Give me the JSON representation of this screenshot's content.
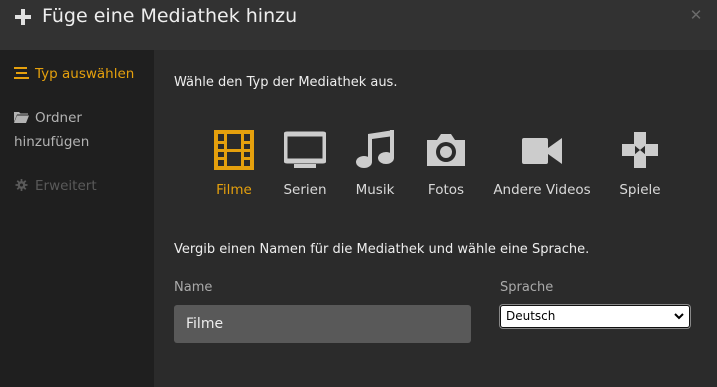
{
  "dialog": {
    "title": "Füge eine Mediathek hinzu"
  },
  "sidebar": {
    "items": [
      {
        "label": "Typ auswählen",
        "state": "active"
      },
      {
        "label": "Ordner hinzufügen",
        "state": "normal"
      },
      {
        "label": "Erweitert",
        "state": "disabled"
      }
    ]
  },
  "main": {
    "intro": "Wähle den Typ der Mediathek aus.",
    "types": [
      {
        "label": "Filme",
        "icon": "film-icon",
        "selected": true
      },
      {
        "label": "Serien",
        "icon": "tv-icon",
        "selected": false
      },
      {
        "label": "Musik",
        "icon": "music-note-icon",
        "selected": false
      },
      {
        "label": "Fotos",
        "icon": "camera-icon",
        "selected": false
      },
      {
        "label": "Andere Videos",
        "icon": "video-camera-icon",
        "selected": false
      },
      {
        "label": "Spiele",
        "icon": "gamepad-icon",
        "selected": false
      }
    ],
    "name_section": "Vergib einen Namen für die Mediathek und wähle eine Sprache.",
    "name_label": "Name",
    "name_value": "Filme",
    "language_label": "Sprache",
    "language_value": "Deutsch"
  },
  "colors": {
    "accent": "#e5a00d",
    "background": "#2a2a2a",
    "sidebar": "#1f1f1f",
    "input": "#595959"
  }
}
